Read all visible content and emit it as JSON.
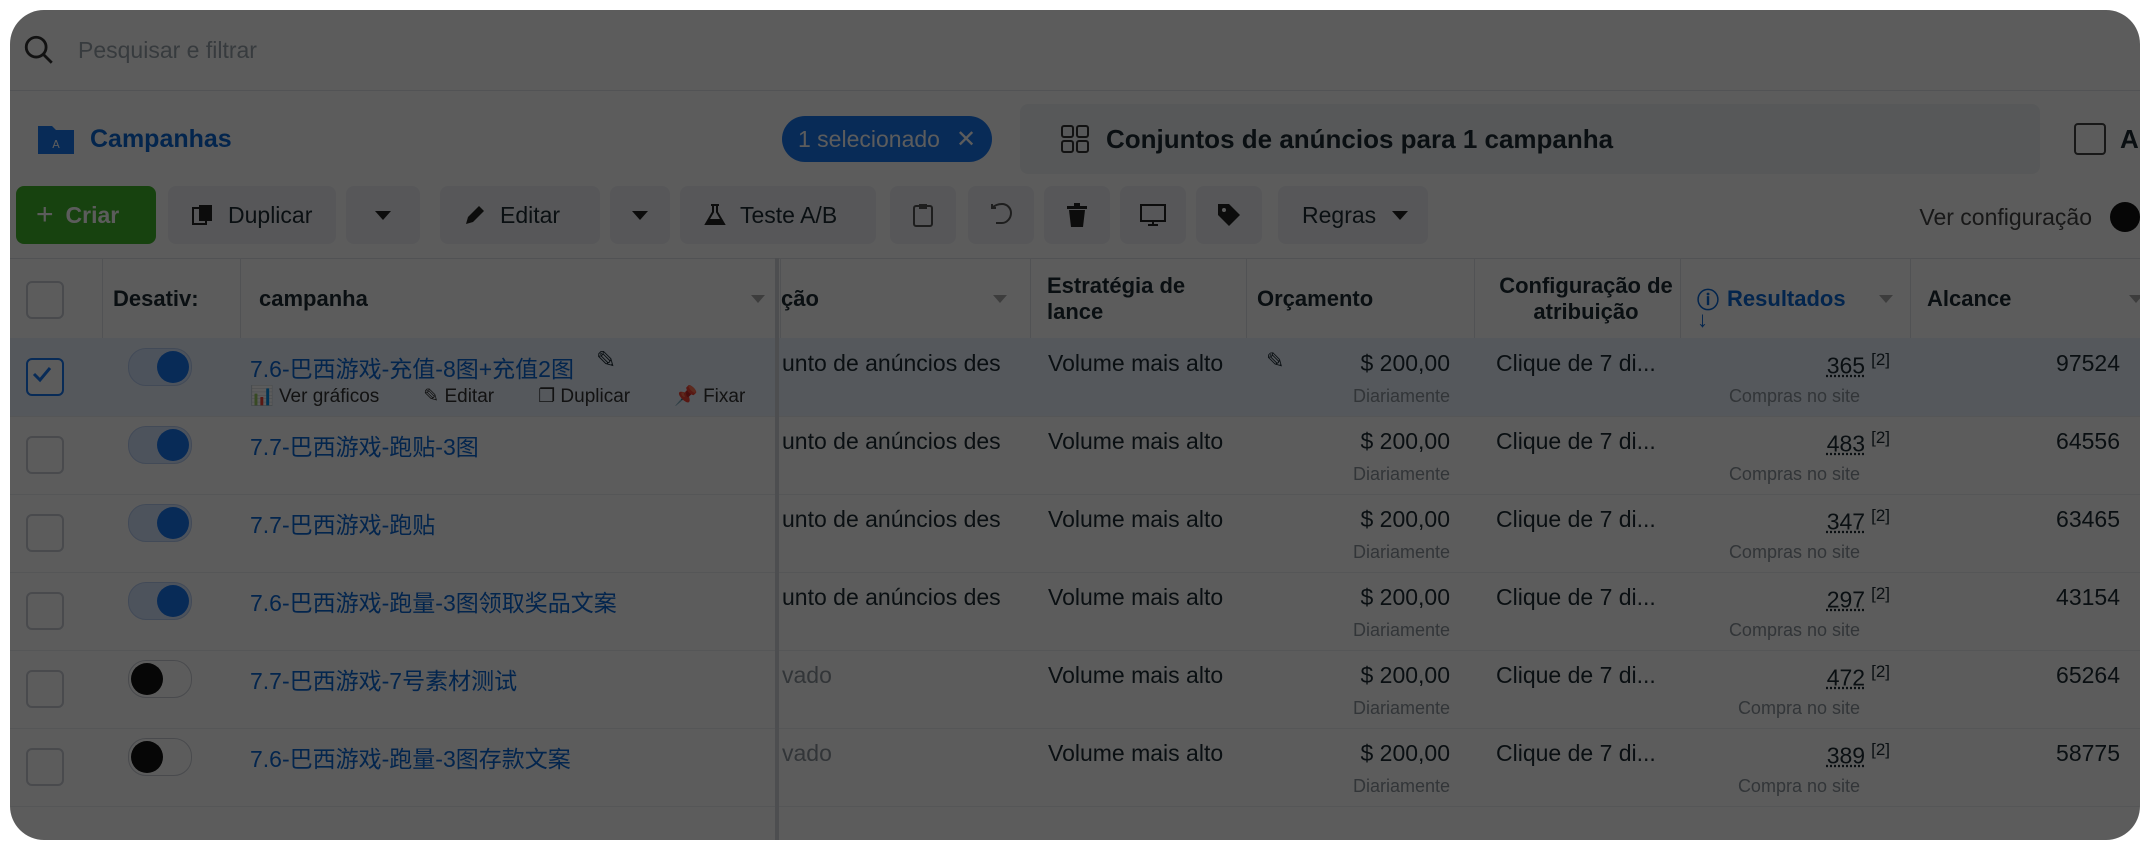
{
  "search": {
    "placeholder": "Pesquisar e filtrar"
  },
  "tabs": {
    "campaigns": "Campanhas",
    "selected_pill": "1 selecionado",
    "adsets": "Conjuntos de anúncios para 1 campanha",
    "ads": "An"
  },
  "toolbar": {
    "create": "Criar",
    "duplicate": "Duplicar",
    "edit": "Editar",
    "ab_test": "Teste A/B",
    "rules": "Regras",
    "view_config": "Ver configuração"
  },
  "columns": {
    "off": "Desativ:",
    "campaign": "campanha",
    "delivery": "ção",
    "bid_strategy": "Estratégia de lance",
    "budget": "Orçamento",
    "attribution": "Configuração de atribuição",
    "results": "Resultados",
    "reach": "Alcance"
  },
  "row_actions": {
    "charts": "Ver gráficos",
    "edit": "Editar",
    "duplicate": "Duplicar",
    "pin": "Fixar"
  },
  "rows": [
    {
      "name": "7.6-巴西游戏-充值-8图+充值2图",
      "delivery": "unto de anúncios des",
      "bid": "Volume mais alto",
      "budget": "$ 200,00",
      "budget_sub": "Diariamente",
      "attribution": "Clique de 7 di...",
      "results": "365",
      "results_ref": "[2]",
      "results_sub": "Compras no site",
      "reach": "97524",
      "on": true,
      "selected": true
    },
    {
      "name": "7.7-巴西游戏-跑贴-3图",
      "delivery": "unto de anúncios des",
      "bid": "Volume mais alto",
      "budget": "$ 200,00",
      "budget_sub": "Diariamente",
      "attribution": "Clique de 7 di...",
      "results": "483",
      "results_ref": "[2]",
      "results_sub": "Compras no site",
      "reach": "64556",
      "on": true,
      "selected": false
    },
    {
      "name": "7.7-巴西游戏-跑贴",
      "delivery": "unto de anúncios des",
      "bid": "Volume mais alto",
      "budget": "$ 200,00",
      "budget_sub": "Diariamente",
      "attribution": "Clique de 7 di...",
      "results": "347",
      "results_ref": "[2]",
      "results_sub": "Compras no site",
      "reach": "63465",
      "on": true,
      "selected": false
    },
    {
      "name": "7.6-巴西游戏-跑量-3图领取奖品文案",
      "delivery": "unto de anúncios des",
      "bid": "Volume mais alto",
      "budget": "$ 200,00",
      "budget_sub": "Diariamente",
      "attribution": "Clique de 7 di...",
      "results": "297",
      "results_ref": "[2]",
      "results_sub": "Compras no site",
      "reach": "43154",
      "on": true,
      "selected": false
    },
    {
      "name": "7.7-巴西游戏-7号素材测试",
      "delivery": "vado",
      "bid": "Volume mais alto",
      "budget": "$ 200,00",
      "budget_sub": "Diariamente",
      "attribution": "Clique de 7 di...",
      "results": "472",
      "results_ref": "[2]",
      "results_sub": "Compra no site",
      "reach": "65264",
      "on": false,
      "selected": false
    },
    {
      "name": "7.6-巴西游戏-跑量-3图存款文案",
      "delivery": "vado",
      "bid": "Volume mais alto",
      "budget": "$ 200,00",
      "budget_sub": "Diariamente",
      "attribution": "Clique de 7 di...",
      "results": "389",
      "results_ref": "[2]",
      "results_sub": "Compra no site",
      "reach": "58775",
      "on": false,
      "selected": false
    }
  ],
  "colors": {
    "accent": "#1877f2",
    "create": "#42b72a",
    "link": "#0a66d6"
  }
}
